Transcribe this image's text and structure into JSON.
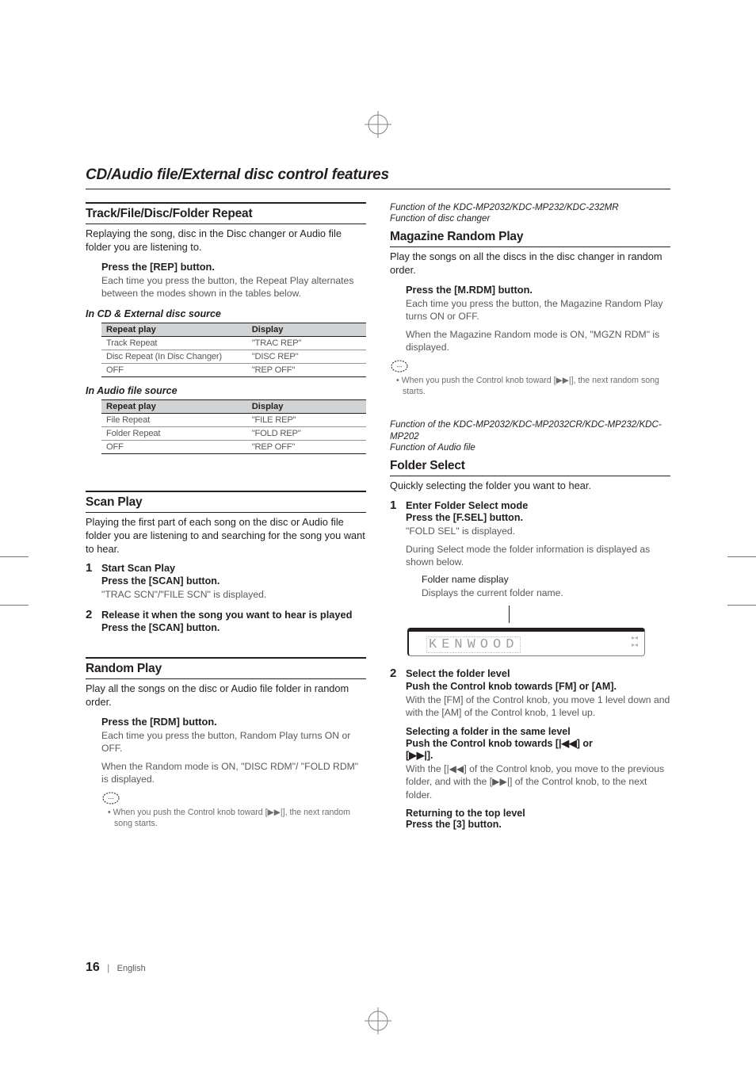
{
  "section_title": "CD/Audio file/External disc control features",
  "page": {
    "number": "16",
    "sep": "|",
    "lang": "English"
  },
  "left": {
    "repeat": {
      "heading": "Track/File/Disc/Folder Repeat",
      "lead": "Replaying the song, disc in the Disc changer or Audio file folder you are listening to.",
      "instr_bold": "Press the [REP] button.",
      "instr_body": "Each time you press the button, the Repeat Play alternates between the modes shown in the tables below.",
      "sub1": "In CD & External disc source",
      "table1": {
        "h1": "Repeat play",
        "h2": "Display",
        "rows": [
          {
            "a": "Track Repeat",
            "b": "\"TRAC REP\""
          },
          {
            "a": "Disc Repeat (In Disc Changer)",
            "b": "\"DISC REP\""
          },
          {
            "a": "OFF",
            "b": "\"REP OFF\""
          }
        ]
      },
      "sub2": "In Audio file source",
      "table2": {
        "h1": "Repeat play",
        "h2": "Display",
        "rows": [
          {
            "a": "File Repeat",
            "b": "\"FILE REP\""
          },
          {
            "a": "Folder Repeat",
            "b": "\"FOLD REP\""
          },
          {
            "a": "OFF",
            "b": "\"REP OFF\""
          }
        ]
      }
    },
    "scan": {
      "heading": "Scan Play",
      "lead": "Playing the first part of each song on the disc or Audio file folder you are listening to and searching for the song you want to hear.",
      "step1_num": "1",
      "step1_title": "Start Scan Play",
      "step1_bold": "Press the [SCAN] button.",
      "step1_body": "\"TRAC SCN\"/\"FILE SCN\" is displayed.",
      "step2_num": "2",
      "step2_title": "Release it when the song you want to hear is played",
      "step2_bold": "Press the [SCAN] button."
    },
    "random": {
      "heading": "Random Play",
      "lead": "Play all the songs on the disc or Audio file folder in random order.",
      "instr_bold": "Press the [RDM] button.",
      "body1": "Each time you press the button, Random Play turns ON or OFF.",
      "body2": "When the Random mode is ON, \"DISC RDM\"/ \"FOLD RDM\" is displayed.",
      "note": "When you push the Control knob toward [▶▶|], the next random song starts."
    }
  },
  "right": {
    "mag": {
      "func1": "Function of the KDC-MP2032/KDC-MP232/KDC-232MR",
      "func2": "Function of disc changer",
      "heading": "Magazine Random Play",
      "lead": "Play the songs on all the discs in the disc changer in random order.",
      "instr_bold": "Press the [M.RDM] button.",
      "body1": "Each time you press the button, the Magazine Random Play turns ON or OFF.",
      "body2": "When the Magazine Random mode is ON, \"MGZN RDM\" is displayed.",
      "note": "When you push the Control knob toward [▶▶|], the next random song starts."
    },
    "folder": {
      "func1": "Function of the KDC-MP2032/KDC-MP2032CR/KDC-MP232/KDC-MP202",
      "func2": "Function of Audio file",
      "heading": "Folder Select",
      "lead": "Quickly selecting the folder you want to hear.",
      "step1_num": "1",
      "step1_title": "Enter Folder Select mode",
      "step1_bold": "Press the [F.SEL] button.",
      "step1_body1": "\"FOLD SEL\" is displayed.",
      "step1_body2": "During Select mode the folder information is displayed as shown below.",
      "step1_sub": "Folder name display",
      "step1_sub_body": "Displays the current folder name.",
      "display_text": "KENWOOD",
      "step2_num": "2",
      "step2_title": "Select the folder level",
      "step2_bold": "Push the Control knob towards [FM] or [AM].",
      "step2_body": "With the [FM] of the Control knob, you move 1 level down and with the [AM] of the Control knob, 1 level up.",
      "sel_same_bold": "Selecting a folder in the same level",
      "sel_same_instr_a": "Push the Control knob towards [|◀◀] or",
      "sel_same_instr_b": "[▶▶|].",
      "sel_same_body": "With the [|◀◀] of the Control knob, you move to the previous folder, and with the [▶▶|] of the Control knob, to the next folder.",
      "ret_bold1": "Returning to the top level",
      "ret_bold2": "Press the [3] button."
    }
  }
}
